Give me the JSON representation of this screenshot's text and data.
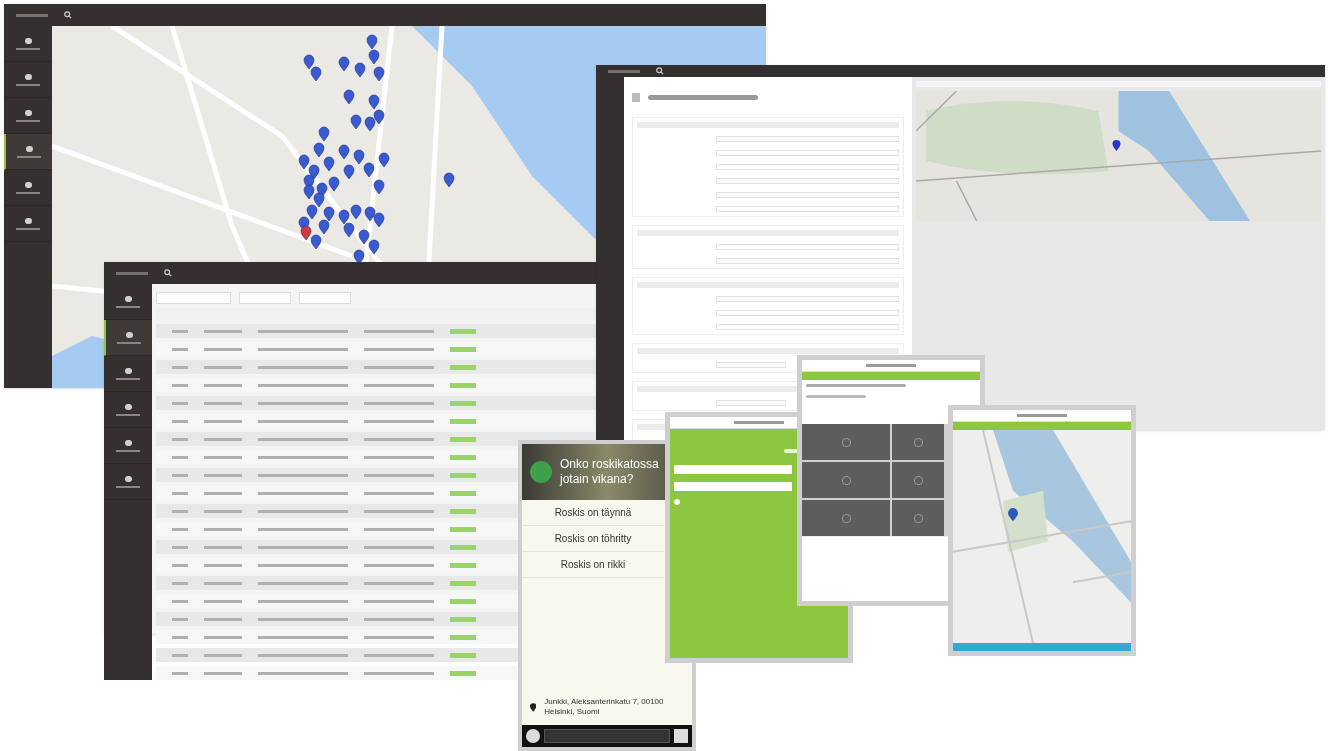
{
  "map_window": {
    "sidebar": [
      {
        "selected": false
      },
      {
        "selected": false
      },
      {
        "selected": false
      },
      {
        "selected": true
      },
      {
        "selected": false
      },
      {
        "selected": false
      }
    ]
  },
  "table_window": {
    "sidebar": [
      {
        "selected": false
      },
      {
        "selected": true
      },
      {
        "selected": false
      },
      {
        "selected": false
      },
      {
        "selected": false
      },
      {
        "selected": false
      }
    ]
  },
  "login": {
    "remember": {
      "checked": true
    }
  },
  "phone": {
    "question": "Onko roskikatossa jotain vikana?",
    "options": [
      "Roskis on täynnä",
      "Roskis on töhritty",
      "Roskis on rikki"
    ],
    "address": "Junkki, Aleksanterinkatu 7, 00100 Helsinki, Suomi"
  }
}
